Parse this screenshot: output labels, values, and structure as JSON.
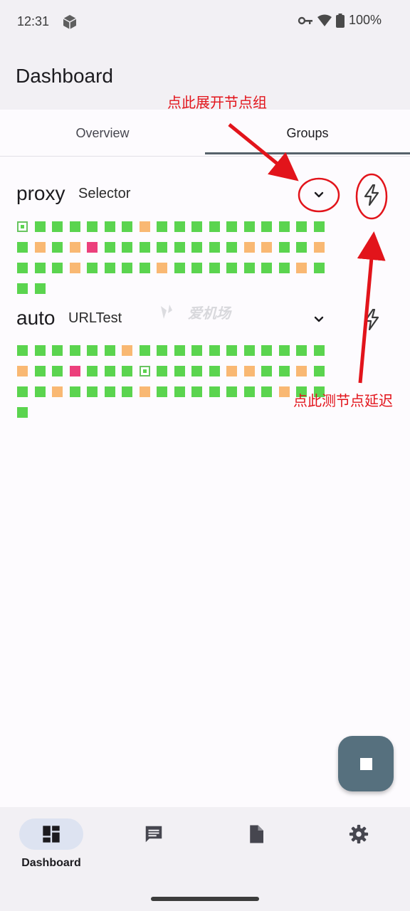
{
  "status_bar": {
    "time": "12:31",
    "battery": "100%"
  },
  "app": {
    "title": "Dashboard"
  },
  "tabs": [
    {
      "label": "Overview",
      "active": false
    },
    {
      "label": "Groups",
      "active": true
    }
  ],
  "groups": [
    {
      "name": "proxy",
      "type": "Selector",
      "nodes": [
        [
          "selected",
          "green",
          "green",
          "green",
          "green",
          "green",
          "green",
          "orange",
          "green",
          "green",
          "green",
          "green",
          "green",
          "green",
          "green",
          "green",
          "green",
          "green"
        ],
        [
          "green",
          "orange",
          "green",
          "orange",
          "pink",
          "green",
          "green",
          "green",
          "green",
          "green",
          "green",
          "green",
          "green",
          "orange",
          "orange",
          "green",
          "green",
          "orange"
        ],
        [
          "green",
          "green",
          "green",
          "orange",
          "green",
          "green",
          "green",
          "green",
          "orange",
          "green",
          "green",
          "green",
          "green",
          "green",
          "green",
          "green",
          "orange",
          "green"
        ],
        [
          "green",
          "green"
        ]
      ]
    },
    {
      "name": "auto",
      "type": "URLTest",
      "nodes": [
        [
          "green",
          "green",
          "green",
          "green",
          "green",
          "green",
          "orange",
          "green",
          "green",
          "green",
          "green",
          "green",
          "green",
          "green",
          "green",
          "green",
          "green",
          "green"
        ],
        [
          "orange",
          "green",
          "green",
          "pink",
          "green",
          "green",
          "green",
          "selected",
          "green",
          "green",
          "green",
          "green",
          "orange",
          "orange",
          "green",
          "green",
          "orange",
          "green"
        ],
        [
          "green",
          "green",
          "orange",
          "green",
          "green",
          "green",
          "green",
          "orange",
          "green",
          "green",
          "green",
          "green",
          "green",
          "green",
          "green",
          "orange",
          "green",
          "green"
        ],
        [
          "green"
        ]
      ]
    }
  ],
  "annotations": {
    "expand_hint": "点此展开节点组",
    "latency_hint": "点此测节点延迟"
  },
  "watermark": "爱机场",
  "bottom_nav": [
    {
      "label": "Dashboard",
      "icon": "dashboard-icon",
      "active": true
    },
    {
      "label": "",
      "icon": "message-icon",
      "active": false
    },
    {
      "label": "",
      "icon": "file-icon",
      "active": false
    },
    {
      "label": "",
      "icon": "settings-icon",
      "active": false
    }
  ],
  "colors": {
    "accent": "#56626b",
    "fab": "#56707e",
    "node_ok": "#5bd44f",
    "node_slow": "#f9b873",
    "node_bad": "#ec3f7c",
    "annotation": "#e2141b"
  }
}
